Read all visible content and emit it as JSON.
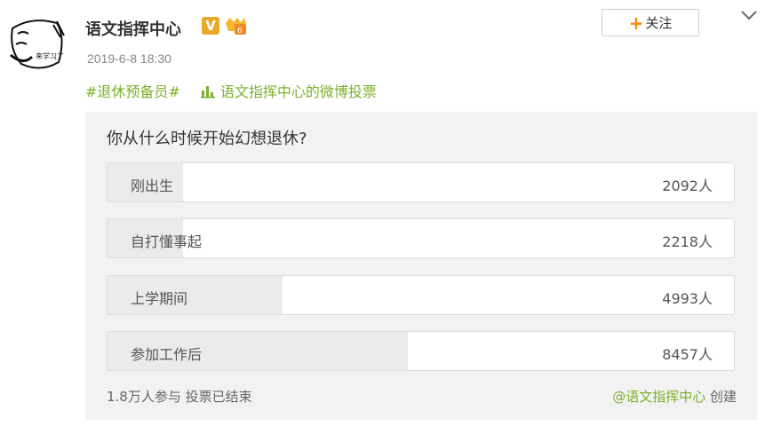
{
  "post": {
    "avatar_text": "来学习了",
    "author": "语文指挥中心",
    "verified_badge": "V",
    "timestamp": "2019-6-8 18:30",
    "follow_label": "关注",
    "topic": "#退休预备员#",
    "poll_link": "语文指挥中心的微博投票"
  },
  "poll": {
    "question": "你从什么时候开始幻想退休?",
    "options": [
      {
        "label": "刚出生",
        "count": "2092人",
        "fraction": 0.12
      },
      {
        "label": "自打懂事起",
        "count": "2218人",
        "fraction": 0.12
      },
      {
        "label": "上学期间",
        "count": "4993人",
        "fraction": 0.28
      },
      {
        "label": "参加工作后",
        "count": "8457人",
        "fraction": 0.48
      }
    ],
    "summary": "1.8万人参与 投票已结束",
    "creator": "@语文指挥中心",
    "created_label": " 创建"
  },
  "colors": {
    "accent_green": "#7caf2b",
    "follow_plus": "#ff8200",
    "badge_gold": "#e8a92b"
  }
}
